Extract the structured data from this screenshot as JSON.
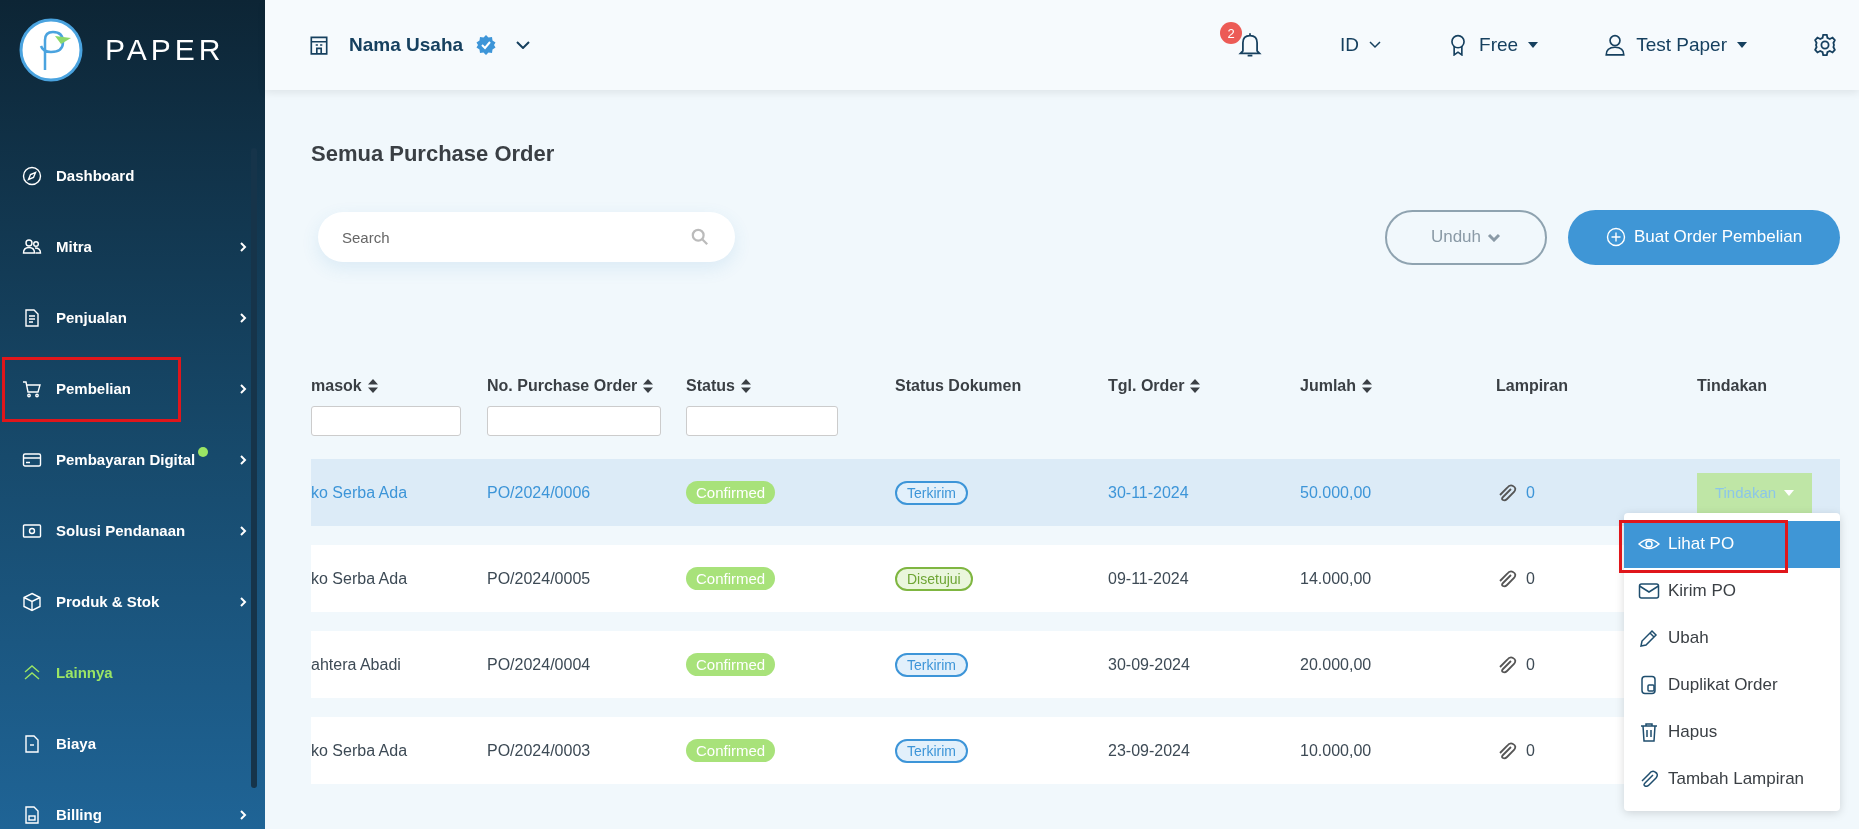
{
  "brand": {
    "name": "PAPER"
  },
  "sidebar": {
    "items": [
      {
        "label": "Dashboard",
        "chevron": false,
        "active": false,
        "dot": false,
        "highlighted": false
      },
      {
        "label": "Mitra",
        "chevron": true,
        "active": false,
        "dot": false,
        "highlighted": false
      },
      {
        "label": "Penjualan",
        "chevron": true,
        "active": false,
        "dot": false,
        "highlighted": false
      },
      {
        "label": "Pembelian",
        "chevron": true,
        "active": false,
        "dot": false,
        "highlighted": true
      },
      {
        "label": "Pembayaran Digital",
        "chevron": true,
        "active": false,
        "dot": true,
        "highlighted": false
      },
      {
        "label": "Solusi Pendanaan",
        "chevron": true,
        "active": false,
        "dot": false,
        "highlighted": false
      },
      {
        "label": "Produk & Stok",
        "chevron": true,
        "active": false,
        "dot": false,
        "highlighted": false
      },
      {
        "label": "Lainnya",
        "chevron": false,
        "active": true,
        "dot": false,
        "highlighted": false
      },
      {
        "label": "Biaya",
        "chevron": false,
        "active": false,
        "dot": false,
        "highlighted": false
      },
      {
        "label": "Billing",
        "chevron": true,
        "active": false,
        "dot": false,
        "highlighted": false
      }
    ]
  },
  "header": {
    "business": "Nama Usaha",
    "verified": true,
    "notifications": "2",
    "language": "ID",
    "plan": "Free",
    "user": "Test Paper"
  },
  "page": {
    "title": "Semua Purchase Order",
    "search": {
      "placeholder": "Search"
    },
    "download_button": "Unduh",
    "create_button": "Buat Order Pembelian"
  },
  "table": {
    "columns": [
      {
        "label": "masok",
        "sortable": true,
        "filter": true
      },
      {
        "label": "No. Purchase Order",
        "sortable": true,
        "filter": true
      },
      {
        "label": "Status",
        "sortable": true,
        "filter": true
      },
      {
        "label": "Status Dokumen",
        "sortable": false,
        "filter": false
      },
      {
        "label": "Tgl. Order",
        "sortable": true,
        "filter": false
      },
      {
        "label": "Jumlah",
        "sortable": true,
        "filter": false
      },
      {
        "label": "Lampiran",
        "sortable": false,
        "filter": false
      },
      {
        "label": "Tindakan",
        "sortable": false,
        "filter": false
      }
    ],
    "rows": [
      {
        "selected": true,
        "supplier": "ko Serba Ada",
        "po_number": "PO/2024/0006",
        "status": "Confirmed",
        "doc_status": {
          "label": "Terkirim",
          "kind": "sent"
        },
        "date": "30-11-2024",
        "amount": "50.000,00",
        "attachments": "0",
        "action": {
          "label": "Tindakan",
          "open": true
        }
      },
      {
        "selected": false,
        "supplier": "ko Serba Ada",
        "po_number": "PO/2024/0005",
        "status": "Confirmed",
        "doc_status": {
          "label": "Disetujui",
          "kind": "approved"
        },
        "date": "09-11-2024",
        "amount": "14.000,00",
        "attachments": "0"
      },
      {
        "selected": false,
        "supplier": "ahtera Abadi",
        "po_number": "PO/2024/0004",
        "status": "Confirmed",
        "doc_status": {
          "label": "Terkirim",
          "kind": "sent"
        },
        "date": "30-09-2024",
        "amount": "20.000,00",
        "attachments": "0"
      },
      {
        "selected": false,
        "supplier": "ko Serba Ada",
        "po_number": "PO/2024/0003",
        "status": "Confirmed",
        "doc_status": {
          "label": "Terkirim",
          "kind": "sent"
        },
        "date": "23-09-2024",
        "amount": "10.000,00",
        "attachments": "0"
      }
    ]
  },
  "action_menu": {
    "items": [
      {
        "label": "Lihat PO",
        "selected": true,
        "highlighted": true
      },
      {
        "label": "Kirim PO",
        "selected": false,
        "highlighted": false
      },
      {
        "label": "Ubah",
        "selected": false,
        "highlighted": false
      },
      {
        "label": "Duplikat Order",
        "selected": false,
        "highlighted": false
      },
      {
        "label": "Hapus",
        "selected": false,
        "highlighted": false
      },
      {
        "label": "Tambah Lampiran",
        "selected": false,
        "highlighted": false
      }
    ]
  }
}
